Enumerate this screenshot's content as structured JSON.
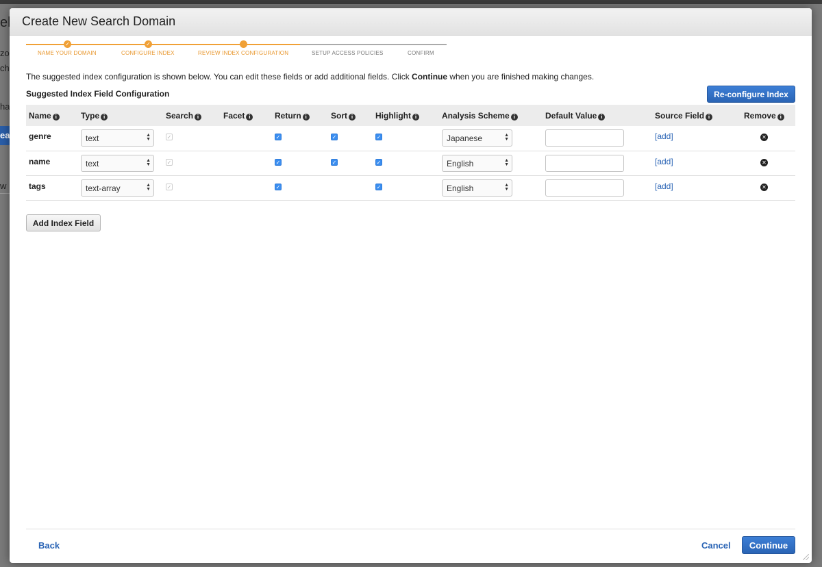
{
  "background": {
    "title_fragment": "elc",
    "fragments": [
      "zor",
      "ch ",
      "hav",
      "w I"
    ],
    "button_fragment": "ea"
  },
  "modal": {
    "title": "Create New Search Domain",
    "steps": [
      {
        "label": "NAME YOUR DOMAIN",
        "state": "done"
      },
      {
        "label": "CONFIGURE INDEX",
        "state": "done"
      },
      {
        "label": "REVIEW INDEX CONFIGURATION",
        "state": "current"
      },
      {
        "label": "SETUP ACCESS POLICIES",
        "state": "todo"
      },
      {
        "label": "CONFIRM",
        "state": "todo"
      }
    ],
    "intro_before": "The suggested index configuration is shown below. You can edit these fields or add additional fields. Click ",
    "intro_bold": "Continue",
    "intro_after": " when you are finished making changes.",
    "section_title": "Suggested Index Field Configuration",
    "reconfigure_label": "Re-configure Index",
    "columns": [
      "Name",
      "Type",
      "Search",
      "Facet",
      "Return",
      "Sort",
      "Highlight",
      "Analysis Scheme",
      "Default Value",
      "Source Field",
      "Remove"
    ],
    "rows": [
      {
        "name": "genre",
        "type": "text",
        "search": true,
        "return": true,
        "sort": true,
        "highlight": true,
        "analysis": "Japanese",
        "default_value": "",
        "source": "[add]"
      },
      {
        "name": "name",
        "type": "text",
        "search": true,
        "return": true,
        "sort": true,
        "highlight": true,
        "analysis": "English",
        "default_value": "",
        "source": "[add]"
      },
      {
        "name": "tags",
        "type": "text-array",
        "search": true,
        "return": true,
        "sort": false,
        "highlight": true,
        "analysis": "English",
        "default_value": "",
        "source": "[add]"
      }
    ],
    "add_field_label": "Add Index Field",
    "back_label": "Back",
    "cancel_label": "Cancel",
    "continue_label": "Continue"
  },
  "colors": {
    "accent": "#f0a036",
    "primary": "#2a64b5",
    "checkbox": "#3b8ef0"
  }
}
